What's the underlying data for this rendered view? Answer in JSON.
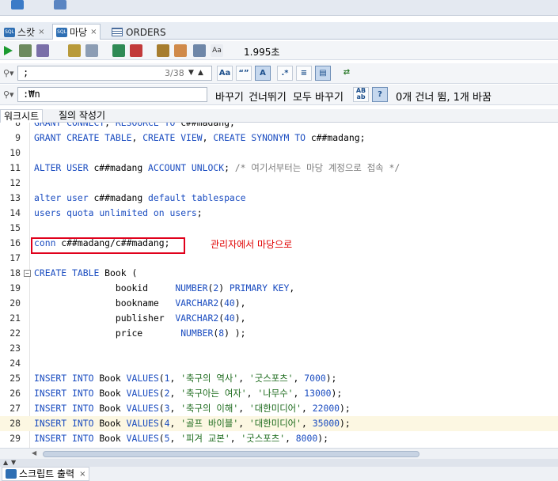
{
  "tabs": [
    {
      "label": "스캇",
      "icon": "sql-icon",
      "active": false
    },
    {
      "label": "마당",
      "icon": "sql-icon",
      "active": true
    },
    {
      "label": "ORDERS",
      "icon": "table-icon",
      "active": false
    }
  ],
  "toolbar": {
    "elapsed": "1.995초"
  },
  "find": {
    "value": ";",
    "count": "3/38"
  },
  "replace": {
    "value": ":₩n",
    "replace_label": "바꾸기",
    "skip_label": "건너뛰기",
    "replace_all_label": "모두 바꾸기",
    "status": "0개 건너 뜀, 1개 바꿈"
  },
  "sheet_tabs": [
    {
      "label": "워크시트",
      "active": true
    },
    {
      "label": "질의 작성기",
      "active": false
    }
  ],
  "annotation": "관리자에서 마당으로",
  "code": [
    {
      "n": "8",
      "text": "GRANT CONNECT, RESOURCE TO c##madang;",
      "partial": true
    },
    {
      "n": "9",
      "text": "GRANT CREATE TABLE, CREATE VIEW, CREATE SYNONYM TO c##madang;"
    },
    {
      "n": "10",
      "text": ""
    },
    {
      "n": "11",
      "text": "ALTER USER c##madang ACCOUNT UNLOCK; /* 여기서부터는 마당 계정으로 접속 */"
    },
    {
      "n": "12",
      "text": ""
    },
    {
      "n": "13",
      "text": "alter user c##madang default tablespace"
    },
    {
      "n": "14",
      "text": "users quota unlimited on users;"
    },
    {
      "n": "15",
      "text": ""
    },
    {
      "n": "16",
      "text": "conn c##madang/c##madang;"
    },
    {
      "n": "17",
      "text": ""
    },
    {
      "n": "18",
      "text": "CREATE TABLE Book (",
      "fold": true
    },
    {
      "n": "19",
      "text": "               bookid     NUMBER(2) PRIMARY KEY,"
    },
    {
      "n": "20",
      "text": "               bookname   VARCHAR2(40),"
    },
    {
      "n": "21",
      "text": "               publisher  VARCHAR2(40),"
    },
    {
      "n": "22",
      "text": "               price       NUMBER(8) );"
    },
    {
      "n": "23",
      "text": ""
    },
    {
      "n": "24",
      "text": ""
    },
    {
      "n": "25",
      "text": "INSERT INTO Book VALUES(1, '축구의 역사', '굿스포츠', 7000);"
    },
    {
      "n": "26",
      "text": "INSERT INTO Book VALUES(2, '축구아는 여자', '나무수', 13000);"
    },
    {
      "n": "27",
      "text": "INSERT INTO Book VALUES(3, '축구의 이해', '대한미디어', 22000);"
    },
    {
      "n": "28",
      "text": "INSERT INTO Book VALUES(4, '골프 바이블', '대한미디어', 35000);",
      "highlight": true
    },
    {
      "n": "29",
      "text": "INSERT INTO Book VALUES(5, '피겨 교본', '굿스포츠', 8000);"
    }
  ],
  "output_tab": {
    "label": "스크립트 출력"
  },
  "colors": {
    "accent": "#1a4cc0",
    "string": "#1b6a1b",
    "annotation": "#e00000",
    "highlight_line": "#fcf7e2"
  }
}
